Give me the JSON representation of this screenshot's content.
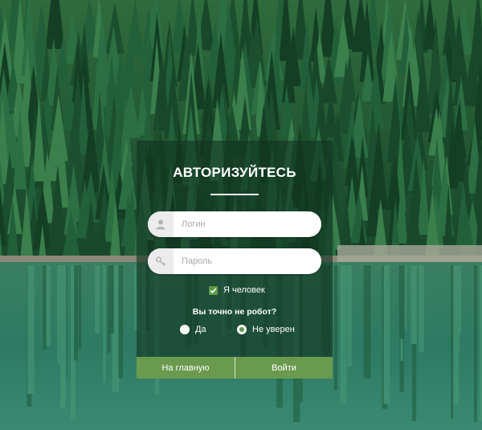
{
  "form": {
    "title": "АВТОРИЗУЙТЕСЬ",
    "login_placeholder": "Логин",
    "password_placeholder": "Пароль",
    "human_label": "Я человек",
    "human_checked": true,
    "question": "Вы точно не робот?",
    "options": [
      {
        "label": "Да",
        "selected": false
      },
      {
        "label": "Не уверен",
        "selected": true
      }
    ],
    "home_button": "На главную",
    "login_button": "Войти"
  },
  "colors": {
    "accent": "#6a9a4e",
    "panel": "#123422",
    "forest": "#1f5b30",
    "water": "#2f7b64"
  },
  "icons": {
    "login_field": "user-icon",
    "password_field": "key-icon",
    "checkbox": "check-icon"
  }
}
